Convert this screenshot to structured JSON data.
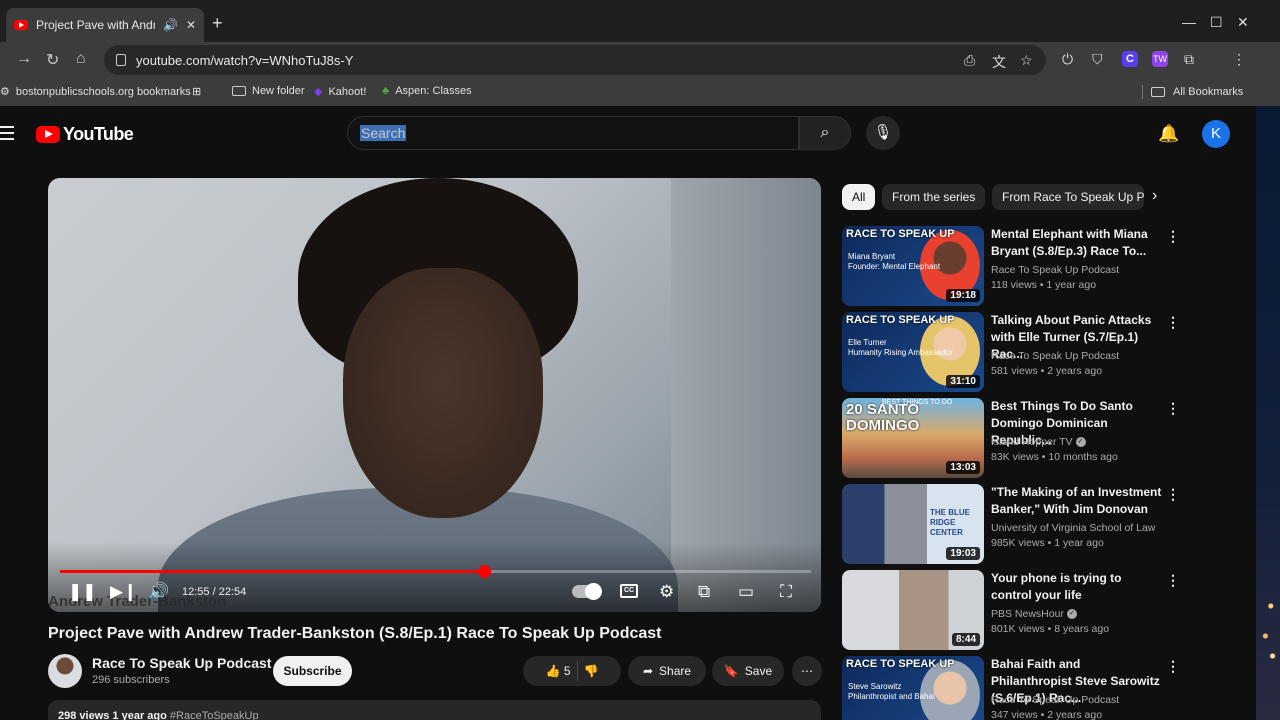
{
  "browser": {
    "tab_title": "Project Pave with Andrew T",
    "new_tab": "+",
    "url": "youtube.com/watch?v=WNhoTuJ8s-Y",
    "bookmarks": [
      {
        "label": "bostonpublicschools.org bookmarks"
      },
      {
        "label": "New folder"
      },
      {
        "label": "Kahoot!"
      },
      {
        "label": "Aspen: Classes"
      }
    ],
    "all_bookmarks": "All Bookmarks",
    "ext_c": "C",
    "ext_p": "TW"
  },
  "youtube": {
    "logo_text": "YouTube",
    "search_placeholder": "Search",
    "avatar_letter": "K"
  },
  "player": {
    "overlay_name": "Andrew Trader-Bankston",
    "time_display": "12:55 / 22:54",
    "progress": 0.564
  },
  "video": {
    "title": "Project Pave with Andrew Trader-Bankston (S.8/Ep.1) Race To Speak Up Podcast",
    "channel": "Race To Speak Up Podcast",
    "subscribers": "296 subscribers",
    "subscribe_label": "Subscribe",
    "likes": "5",
    "share_label": "Share",
    "save_label": "Save",
    "views_time": "298 views  1 year ago",
    "hashtag": "#RaceToSpeakUp"
  },
  "chips": [
    "All",
    "From the series",
    "From Race To Speak Up P"
  ],
  "recommendations": [
    {
      "title": "Mental Elephant with Miana Bryant (S.8/Ep.3) Race To...",
      "channel": "Race To Speak Up Podcast",
      "verified": false,
      "stats": "118 views • 1 year ago",
      "duration": "19:18",
      "overlay": "RACE TO SPEAK UP",
      "overlay_sub": "Miana Bryant\nFounder: Mental Elephant"
    },
    {
      "title": "Talking About Panic Attacks with Elle Turner (S.7/Ep.1) Rac...",
      "channel": "Race To Speak Up Podcast",
      "verified": false,
      "stats": "581 views • 2 years ago",
      "duration": "31:10",
      "overlay": "RACE TO SPEAK UP",
      "overlay_sub": "Elle Turner\nHumanity Rising Ambassador"
    },
    {
      "title": "Best Things To Do Santo Domingo Dominican Republic...",
      "channel": "Island Hopper TV",
      "verified": true,
      "stats": "83K views • 10 months ago",
      "duration": "13:03",
      "overlay": "20 SANTO DOMINGO",
      "overlay_sub": "BEST THINGS TO DO"
    },
    {
      "title": "\"The Making of an Investment Banker,\" With Jim Donovan",
      "channel": "University of Virginia School of Law",
      "verified": false,
      "stats": "985K views • 1 year ago",
      "duration": "19:03",
      "overlay": "",
      "overlay_sub": "THE BLUE RIDGE CENTER"
    },
    {
      "title": "Your phone is trying to control your life",
      "channel": "PBS NewsHour",
      "verified": true,
      "stats": "801K views • 8 years ago",
      "duration": "8:44",
      "overlay": "",
      "overlay_sub": ""
    },
    {
      "title": "Bahai Faith and Philanthropist Steve Sarowitz (S.6/Ep.1) Rac...",
      "channel": "Race To Speak Up Podcast",
      "verified": false,
      "stats": "347 views • 2 years ago",
      "duration": "",
      "overlay": "RACE TO SPEAK UP",
      "overlay_sub": "Steve Sarowitz\nPhilanthropist and Bahai"
    }
  ]
}
